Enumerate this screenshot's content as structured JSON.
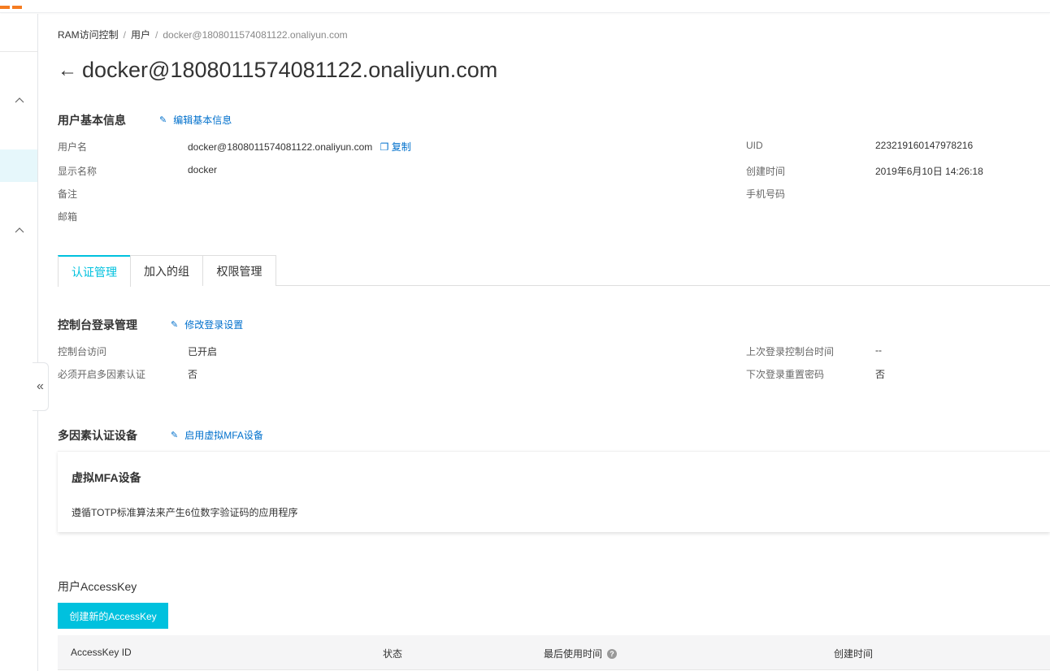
{
  "breadcrumb": {
    "root": "RAM访问控制",
    "sep1": "/",
    "users": "用户",
    "sep2": "/",
    "current": "docker@1808011574081122.onaliyun.com"
  },
  "page": {
    "back_icon": "←",
    "title": "docker@1808011574081122.onaliyun.com"
  },
  "basic_info": {
    "title": "用户基本信息",
    "edit_link": "编辑基本信息",
    "username_label": "用户名",
    "username_value": "docker@1808011574081122.onaliyun.com",
    "copy_label": "复制",
    "display_name_label": "显示名称",
    "display_name_value": "docker",
    "note_label": "备注",
    "email_label": "邮箱",
    "uid_label": "UID",
    "uid_value": "223219160147978216",
    "created_label": "创建时间",
    "created_value": "2019年6月10日 14:26:18",
    "phone_label": "手机号码"
  },
  "tabs": [
    {
      "label": "认证管理",
      "active": true
    },
    {
      "label": "加入的组",
      "active": false
    },
    {
      "label": "权限管理",
      "active": false
    }
  ],
  "console_login": {
    "title": "控制台登录管理",
    "edit_link": "修改登录设置",
    "access_label": "控制台访问",
    "access_value": "已开启",
    "mfa_required_label": "必须开启多因素认证",
    "mfa_required_value": "否",
    "last_login_label": "上次登录控制台时间",
    "last_login_value": "--",
    "reset_pwd_label": "下次登录重置密码",
    "reset_pwd_value": "否"
  },
  "mfa": {
    "title": "多因素认证设备",
    "enable_link": "启用虚拟MFA设备",
    "card_title": "虚拟MFA设备",
    "card_desc": "遵循TOTP标准算法来产生6位数字验证码的应用程序"
  },
  "accesskey": {
    "title": "用户AccessKey",
    "create_button": "创建新的AccessKey",
    "columns": [
      "AccessKey ID",
      "状态",
      "最后使用时间",
      "创建时间"
    ]
  },
  "colors": {
    "accent": "#00c1de",
    "link": "#0070cc",
    "brand": "#f57c21"
  }
}
